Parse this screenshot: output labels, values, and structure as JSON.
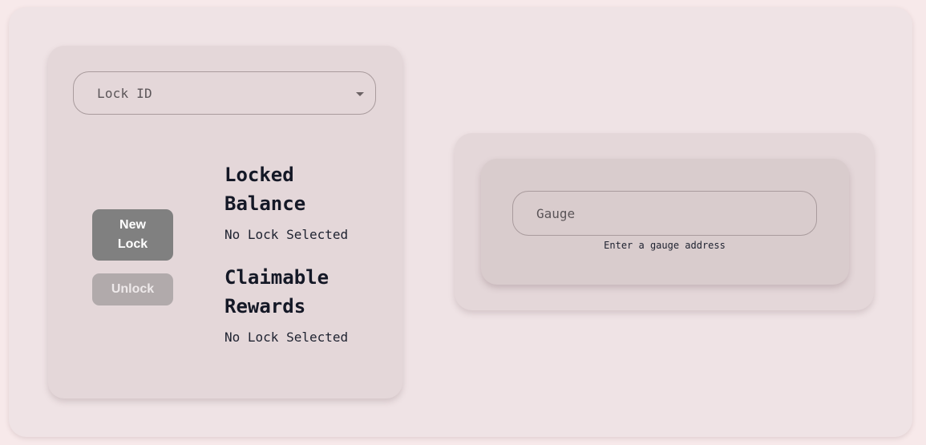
{
  "lock_panel": {
    "lock_id_placeholder": "Lock ID",
    "new_lock_label": "New\nLock",
    "unlock_label": "Unlock",
    "locked_balance_title": "Locked Balance",
    "locked_balance_value": "No Lock Selected",
    "claimable_rewards_title": "Claimable Rewards",
    "claimable_rewards_value": "No Lock Selected"
  },
  "gauge_panel": {
    "gauge_placeholder": "Gauge",
    "helper_text": "Enter a gauge address"
  },
  "colors": {
    "page_background": "#f7e9ea",
    "card_background": "#e4d7d9",
    "new_lock_button": "#808080",
    "unlock_button_disabled": "#b1aaab",
    "heading_text": "#141826"
  },
  "icons": {
    "dropdown": "chevron-down-icon"
  }
}
